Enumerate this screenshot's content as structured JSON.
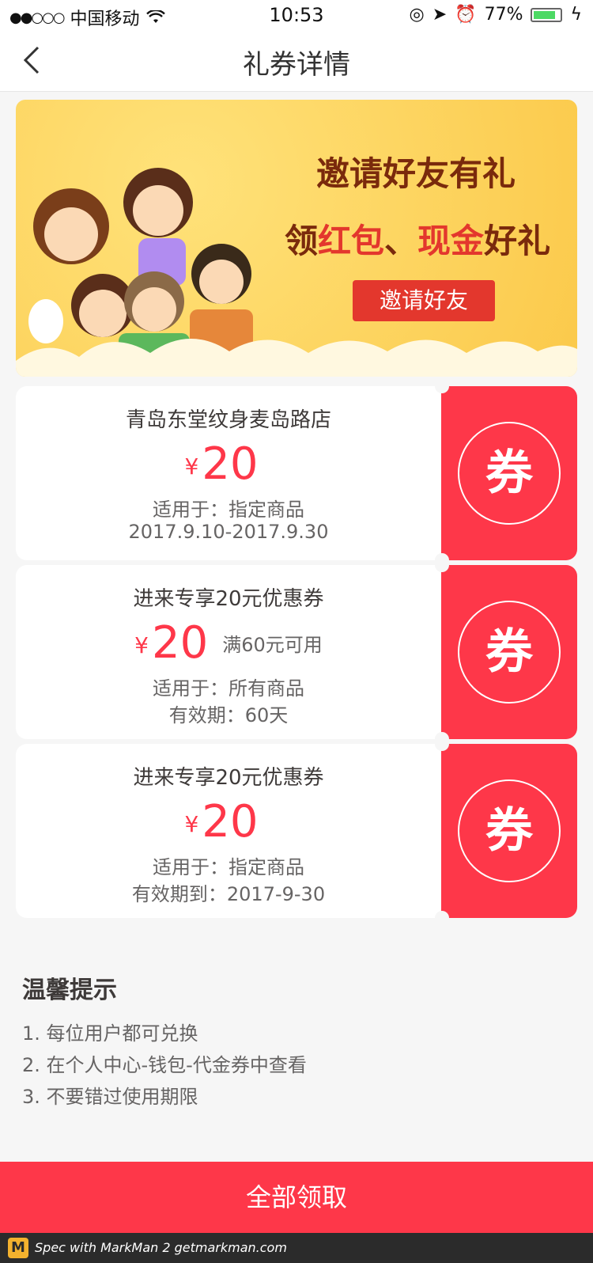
{
  "status_bar": {
    "signal": "●●○○○",
    "carrier": "中国移动",
    "time": "10:53",
    "battery": "77%"
  },
  "nav": {
    "title": "礼券详情"
  },
  "banner": {
    "headline": "邀请好友有礼",
    "subline_prefix": "领",
    "subline_red1": "红包",
    "subline_mid": "、",
    "subline_red2": "现金",
    "subline_suffix": "好礼",
    "button": "邀请好友"
  },
  "coupons": [
    {
      "name": "青岛东堂纹身麦岛路店",
      "yen": "¥",
      "amount": "20",
      "condition": "",
      "line1": "适用于：指定商品",
      "line2": "2017.9.10-2017.9.30",
      "stub": "券"
    },
    {
      "name": "进来专享20元优惠券",
      "yen": "¥",
      "amount": "20",
      "condition": "满60元可用",
      "line1": "适用于：所有商品",
      "line2": "有效期：60天",
      "stub": "券"
    },
    {
      "name": "进来专享20元优惠券",
      "yen": "¥",
      "amount": "20",
      "condition": "",
      "line1": "适用于：指定商品",
      "line2": "有效期到：2017-9-30",
      "stub": "券"
    }
  ],
  "tips": {
    "title": "温馨提示",
    "items": [
      "1. 每位用户都可兑换",
      "2. 在个人中心-钱包-代金券中查看",
      "3. 不要错过使用期限"
    ]
  },
  "claim_button": "全部领取",
  "footer": {
    "logo": "M",
    "text": "Spec with MarkMan 2 getmarkman.com"
  },
  "colors": {
    "accent": "#fe3749",
    "title_text": "#3e3a39",
    "body_text": "#666464",
    "background": "#f6f6f6",
    "white": "#ffffff"
  }
}
